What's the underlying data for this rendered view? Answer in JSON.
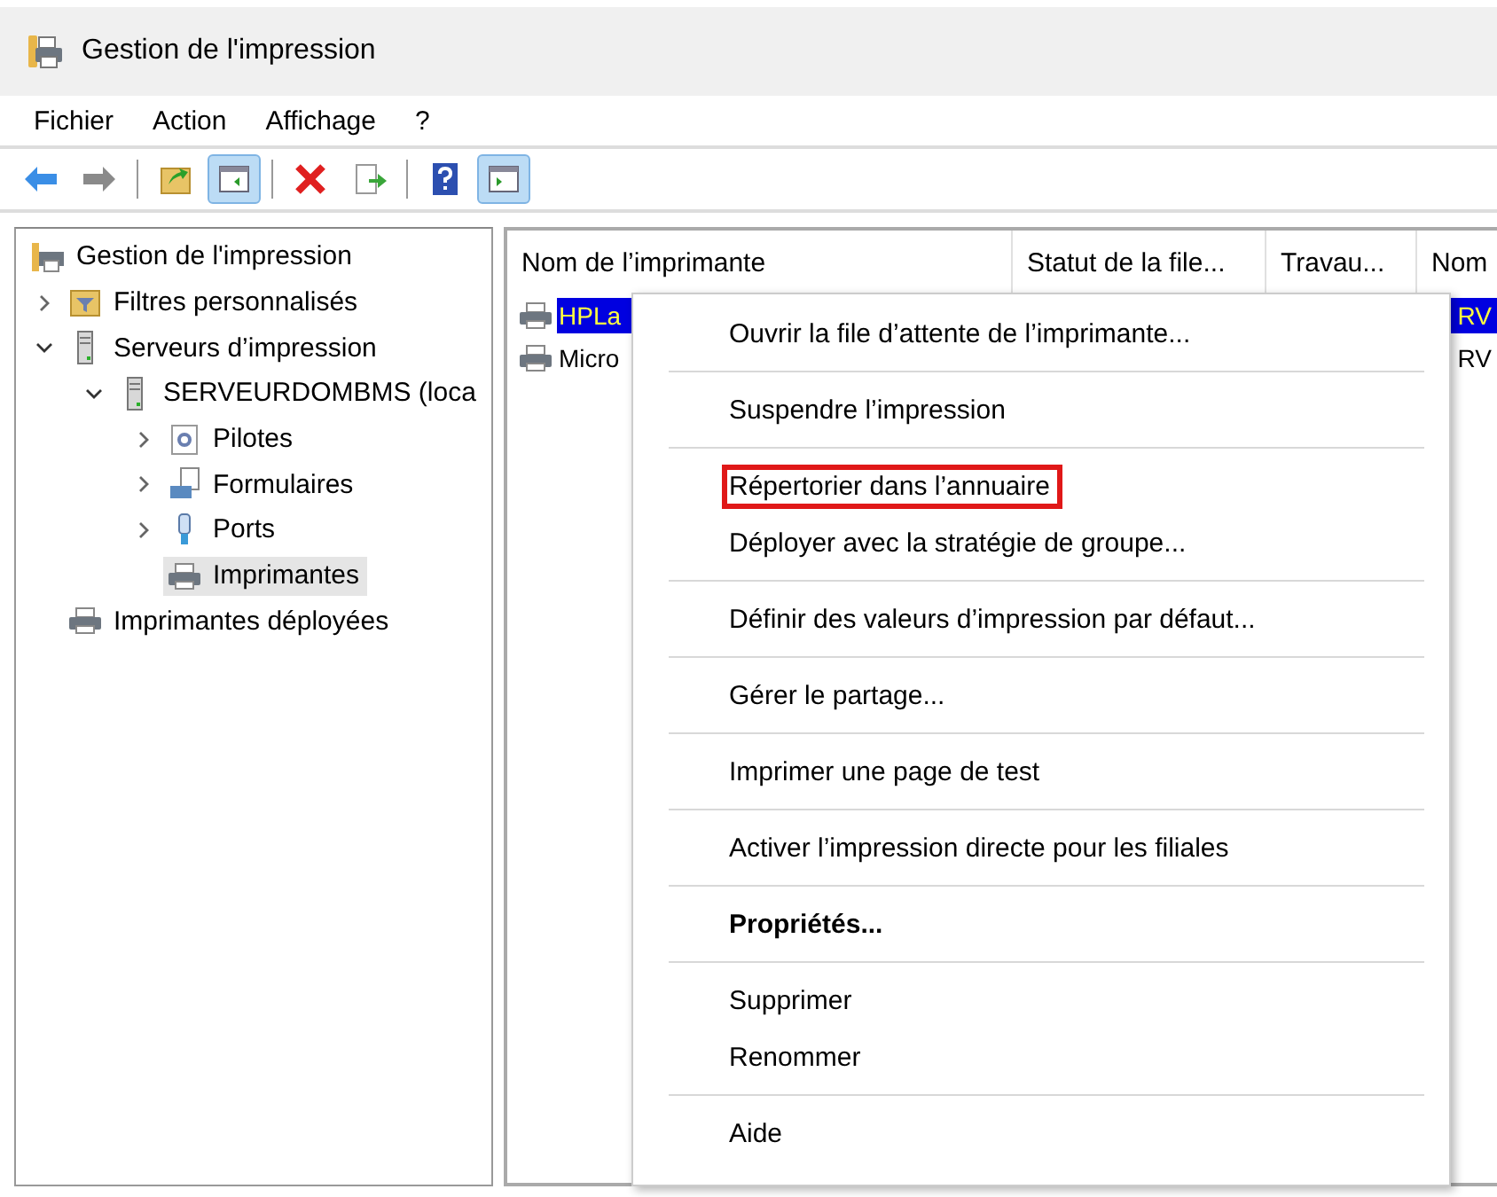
{
  "window": {
    "title": "Gestion de l'impression"
  },
  "menu_bar": [
    "Fichier",
    "Action",
    "Affichage",
    "?"
  ],
  "toolbar": [
    [
      {
        "kind": "back",
        "pressed": false
      },
      {
        "kind": "forward",
        "pressed": false
      }
    ],
    [
      {
        "kind": "up",
        "pressed": false
      },
      {
        "kind": "tree-pane",
        "pressed": true
      }
    ],
    [
      {
        "kind": "delete",
        "pressed": false
      },
      {
        "kind": "export",
        "pressed": false
      }
    ],
    [
      {
        "kind": "help",
        "pressed": false
      },
      {
        "kind": "action-pane",
        "pressed": true
      }
    ]
  ],
  "tree": [
    {
      "label": "Gestion de l'impression",
      "kind": "root",
      "selected": false,
      "children": [
        {
          "label": "Filtres personnalisés",
          "kind": "filter",
          "selected": false,
          "expanded": false
        },
        {
          "label": "Serveurs d’impression",
          "kind": "server",
          "selected": false,
          "expanded": true,
          "children": [
            {
              "label": "SERVEURDOMBMS (loca",
              "kind": "server",
              "selected": false,
              "expanded": true,
              "children": [
                {
                  "label": "Pilotes",
                  "kind": "drivers",
                  "selected": false,
                  "expanded": false
                },
                {
                  "label": "Formulaires",
                  "kind": "forms",
                  "selected": false,
                  "expanded": false
                },
                {
                  "label": "Ports",
                  "kind": "port",
                  "selected": false,
                  "expanded": false
                },
                {
                  "label": "Imprimantes",
                  "kind": "printer",
                  "selected": true
                }
              ]
            }
          ]
        },
        {
          "label": "Imprimantes déployées",
          "kind": "printer",
          "selected": false
        }
      ]
    }
  ],
  "table": {
    "columns": [
      "Nom de l’imprimante",
      "Statut de la file...",
      "Travau...",
      "Nom"
    ],
    "rows": [
      {
        "name": "HPLa",
        "column_4": "RV",
        "selected": true
      },
      {
        "name": "Micro",
        "column_4": "RV",
        "selected": false
      }
    ]
  },
  "context_menu": [
    [
      {
        "label": "Ouvrir la file d’attente de l’imprimante...",
        "bold": false,
        "highlighted": false
      }
    ],
    [
      {
        "label": "Suspendre l’impression",
        "bold": false,
        "highlighted": false
      }
    ],
    [
      {
        "label": "Répertorier dans l’annuaire",
        "bold": false,
        "highlighted": true
      },
      {
        "label": "Déployer avec la stratégie de groupe...",
        "bold": false,
        "highlighted": false
      }
    ],
    [
      {
        "label": "Définir des valeurs d’impression par défaut...",
        "bold": false,
        "highlighted": false
      }
    ],
    [
      {
        "label": "Gérer le partage...",
        "bold": false,
        "highlighted": false
      }
    ],
    [
      {
        "label": "Imprimer une page de test",
        "bold": false,
        "highlighted": false
      }
    ],
    [
      {
        "label": "Activer l’impression directe pour les filiales",
        "bold": false,
        "highlighted": false
      }
    ],
    [
      {
        "label": "Propriétés...",
        "bold": true,
        "highlighted": false
      }
    ],
    [
      {
        "label": "Supprimer",
        "bold": false,
        "highlighted": false
      },
      {
        "label": "Renommer",
        "bold": false,
        "highlighted": false
      }
    ],
    [
      {
        "label": "Aide",
        "bold": false,
        "highlighted": false
      }
    ]
  ]
}
